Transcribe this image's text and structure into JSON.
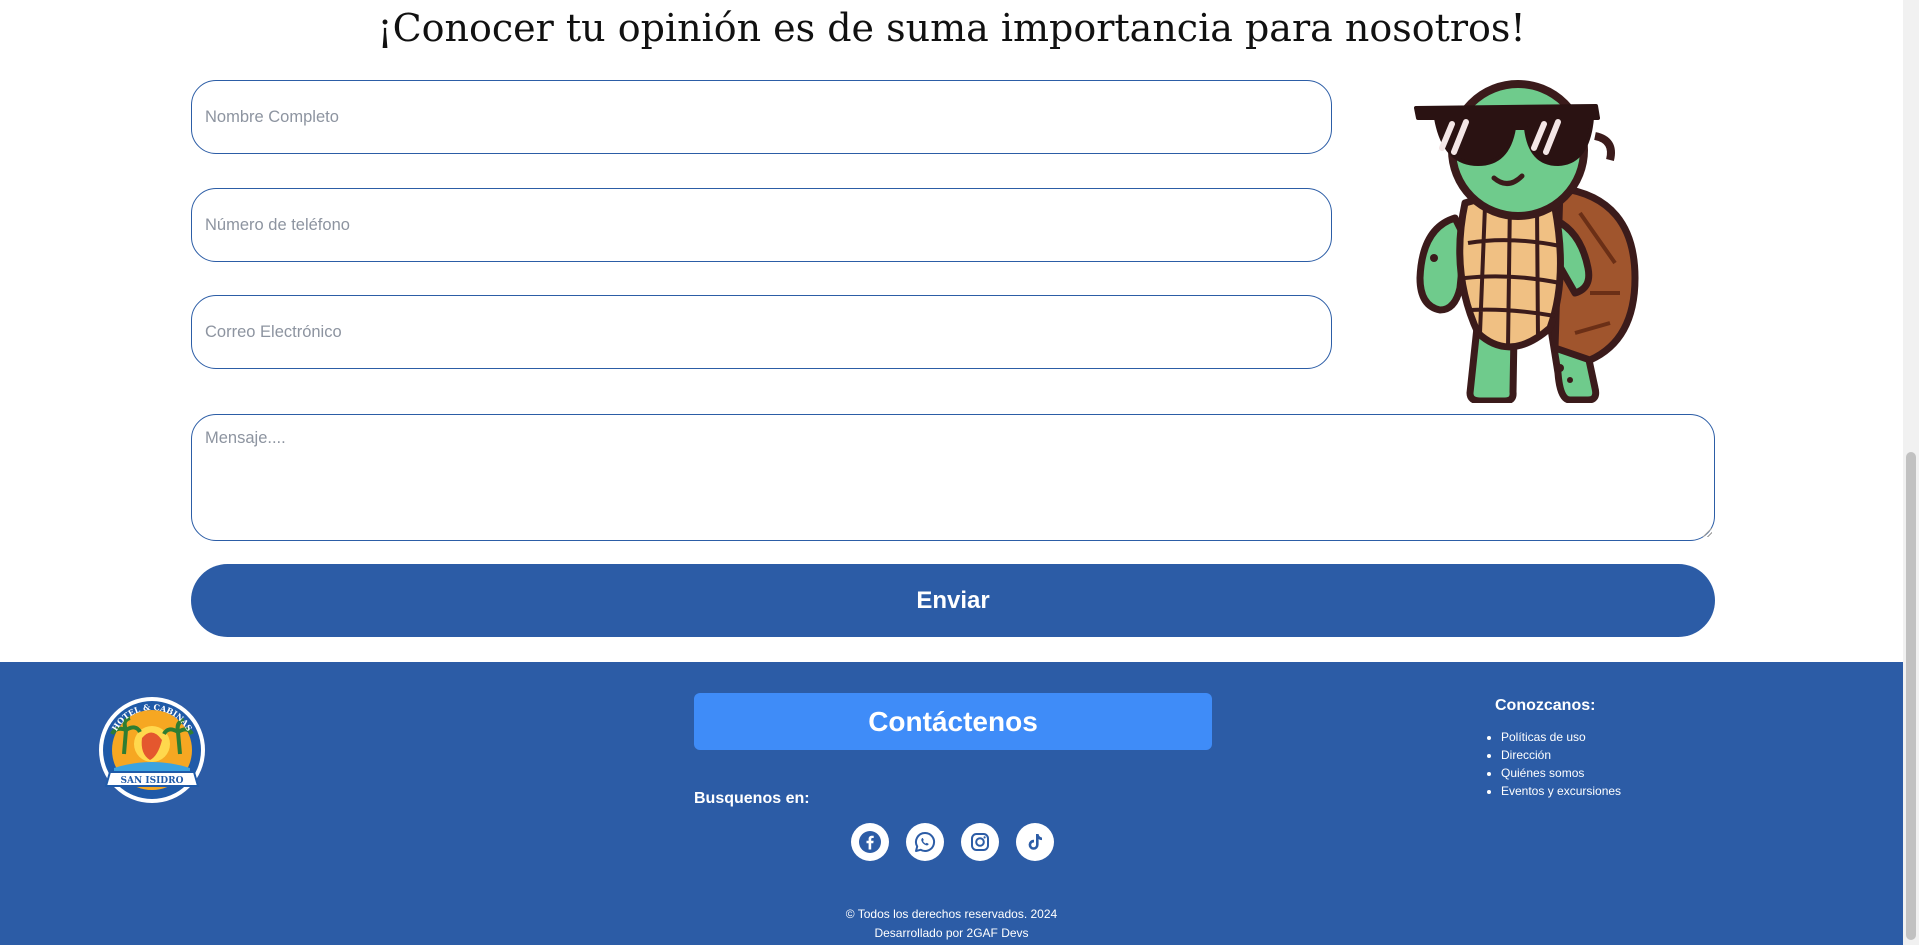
{
  "heading": "¡Conocer tu opinión es de suma importancia para nosotros!",
  "form": {
    "name_placeholder": "Nombre Completo",
    "phone_placeholder": "Número de teléfono",
    "email_placeholder": "Correo Electrónico",
    "message_placeholder": "Mensaje....",
    "submit_label": "Enviar"
  },
  "footer": {
    "logo_text_top": "HOTEL & CABINAS",
    "logo_text_bottom": "SAN ISIDRO",
    "contact_label": "Contáctenos",
    "find_us_label": "Busquenos en:",
    "socials": [
      "facebook-icon",
      "whatsapp-icon",
      "instagram-icon",
      "tiktok-icon"
    ],
    "know_us_title": "Conozcanos:",
    "know_us_links": [
      "Políticas de uso",
      "Dirección",
      "Quiénes somos",
      "Eventos y excursiones"
    ],
    "copyright": "© Todos los derechos reservados. 2024",
    "developer": "Desarrollado por 2GAF Devs"
  },
  "colors": {
    "primary": "#2c5ca6",
    "contact_button": "#3f8cf8",
    "turtle_skin": "#6fcb8c",
    "turtle_shell": "#f0c083"
  }
}
